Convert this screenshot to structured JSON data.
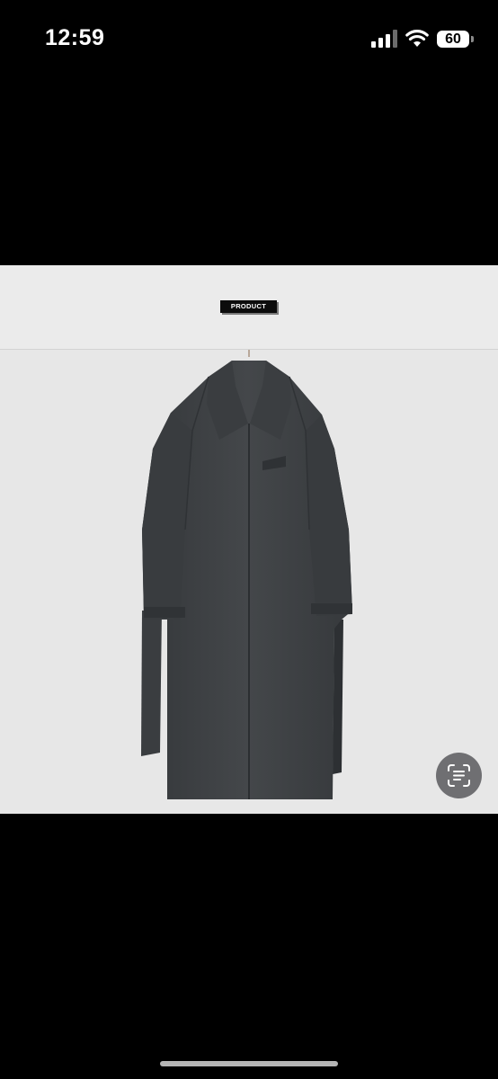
{
  "status_bar": {
    "time": "12:59",
    "battery_level": "60",
    "signal_icon": "cellular-signal-icon",
    "wifi_icon": "wifi-icon"
  },
  "banner": {
    "label": "PRODUCT"
  },
  "photo": {
    "subject_icon": "coat-photo"
  },
  "lens_button": {
    "icon": "visual-lookup-icon"
  },
  "colors": {
    "background": "#000000",
    "banner_bg": "#ebebeb",
    "photo_bg": "#e7e7e7",
    "coat": "#3d4043",
    "label_bg": "#0c0c0c"
  }
}
